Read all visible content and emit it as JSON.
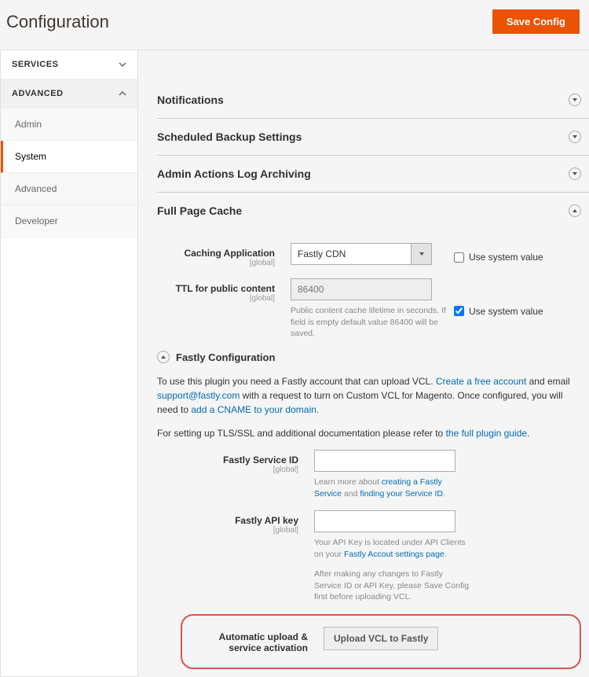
{
  "header": {
    "title": "Configuration",
    "save_label": "Save Config"
  },
  "sidebar": {
    "sections": [
      {
        "label": "SERVICES",
        "expanded": false
      },
      {
        "label": "ADVANCED",
        "expanded": true,
        "items": [
          {
            "label": "Admin",
            "active": false
          },
          {
            "label": "System",
            "active": true
          },
          {
            "label": "Advanced",
            "active": false
          },
          {
            "label": "Developer",
            "active": false
          }
        ]
      }
    ]
  },
  "main": {
    "sections": [
      {
        "title": "Notifications",
        "open": false
      },
      {
        "title": "Scheduled Backup Settings",
        "open": false
      },
      {
        "title": "Admin Actions Log Archiving",
        "open": false
      },
      {
        "title": "Full Page Cache",
        "open": true
      }
    ],
    "fpc": {
      "caching_app_label": "Caching Application",
      "caching_app_scope": "[global]",
      "caching_app_value": "Fastly CDN",
      "use_system_value_label": "Use system value",
      "caching_use_system": false,
      "ttl_label": "TTL for public content",
      "ttl_scope": "[global]",
      "ttl_value": "86400",
      "ttl_use_system": true,
      "ttl_hint": "Public content cache lifetime in seconds. If field is empty default value 86400 will be saved.",
      "fastly_section_title": "Fastly Configuration",
      "fastly_desc_1a": "To use this plugin you need a Fastly account that can upload VCL. ",
      "fastly_link_create": "Create a free account",
      "fastly_desc_1b": " and email ",
      "fastly_link_support": "support@fastly.com",
      "fastly_desc_1c": " with a request to turn on Custom VCL for Magento. Once configured, you will need to ",
      "fastly_link_cname": "add a CNAME to your domain",
      "fastly_desc_1d": ".",
      "fastly_desc_2a": "For setting up TLS/SSL and additional documentation please refer to ",
      "fastly_link_guide": "the full plugin guide",
      "fastly_desc_2b": ".",
      "service_id_label": "Fastly Service ID",
      "service_id_scope": "[global]",
      "service_id_hint_a": "Learn more about ",
      "service_id_link_1": "creating a Fastly Service",
      "service_id_hint_b": " and ",
      "service_id_link_2": "finding your Service ID",
      "service_id_hint_c": ".",
      "api_key_label": "Fastly API key",
      "api_key_scope": "[global]",
      "api_key_hint_a": "Your API Key is located under API Clients on your ",
      "api_key_link": "Fastly Accout settings page",
      "api_key_hint_b": ".",
      "api_key_hint_2": "After making any changes to Fastly Service ID or API Key, please Save Config first before uploading VCL.",
      "auto_upload_label": "Automatic upload & service activation",
      "upload_btn_label": "Upload VCL to Fastly"
    }
  }
}
